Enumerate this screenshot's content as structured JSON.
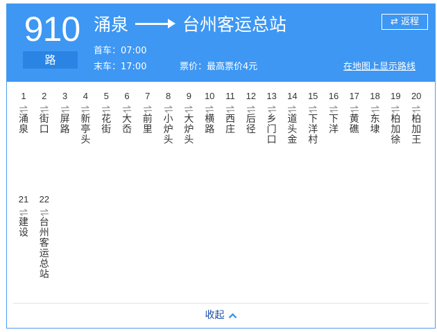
{
  "route": {
    "number": "910",
    "suffix": "路",
    "origin": "涌泉",
    "destination": "台州客运总站",
    "reverse_label": "⇄ 返程",
    "first_bus": "首车：07:00",
    "last_bus": "末车：17:00",
    "fare": "票价：最高票价4元",
    "map_link": "在地图上显示路线"
  },
  "stops": [
    {
      "index": "1",
      "name": "涌泉"
    },
    {
      "index": "2",
      "name": "街口"
    },
    {
      "index": "3",
      "name": "屏路"
    },
    {
      "index": "4",
      "name": "新亭头"
    },
    {
      "index": "5",
      "name": "花街"
    },
    {
      "index": "6",
      "name": "大岙"
    },
    {
      "index": "7",
      "name": "前里"
    },
    {
      "index": "8",
      "name": "小炉头"
    },
    {
      "index": "9",
      "name": "大炉头"
    },
    {
      "index": "10",
      "name": "横路"
    },
    {
      "index": "11",
      "name": "西庄"
    },
    {
      "index": "12",
      "name": "后径"
    },
    {
      "index": "13",
      "name": "乡门口"
    },
    {
      "index": "14",
      "name": "道头金"
    },
    {
      "index": "15",
      "name": "下洋村"
    },
    {
      "index": "16",
      "name": "下洋"
    },
    {
      "index": "17",
      "name": "黄礁"
    },
    {
      "index": "18",
      "name": "东埭"
    },
    {
      "index": "19",
      "name": "柏加徐"
    },
    {
      "index": "20",
      "name": "柏加王"
    },
    {
      "index": "21",
      "name": "建设"
    },
    {
      "index": "22",
      "name": "台州客运总站"
    }
  ],
  "collapse_label": "收起",
  "colors": {
    "header_bg": "#3d97f3",
    "suffix_bg": "#2a84e3",
    "border": "#4a9cf0",
    "collapse_link": "#1a4ea6",
    "chevron": "#3d97f3",
    "swap_icon": "#999999"
  },
  "icons": {
    "route_arrow": "long-right-arrow-icon",
    "stop_swap": "swap-arrows-icon",
    "collapse": "chevron-up-icon"
  }
}
